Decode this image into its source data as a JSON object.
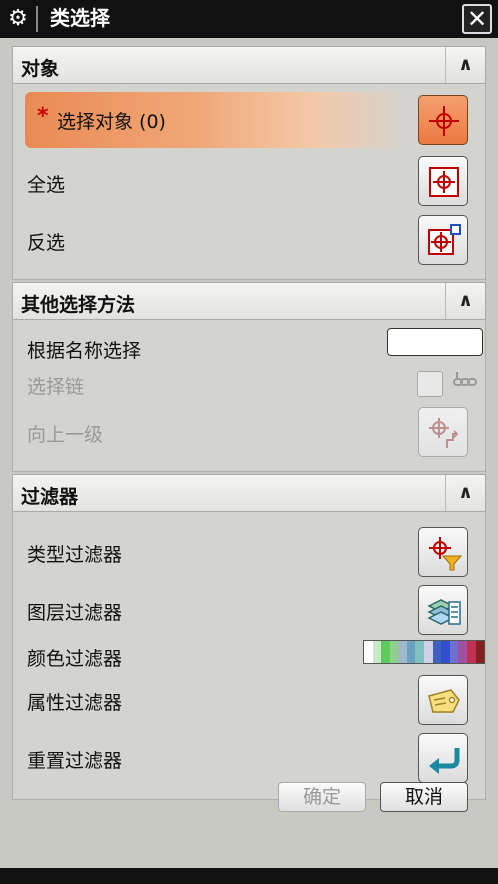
{
  "window": {
    "title": "类选择",
    "close_label": "✕",
    "gear_icon": "⚙"
  },
  "sections": {
    "object": {
      "title": "对象",
      "collapse": "∧",
      "select_object": {
        "star": "*",
        "label": "选择对象 (0)"
      },
      "select_all": "全选",
      "invert": "反选"
    },
    "other": {
      "title": "其他选择方法",
      "collapse": "∧",
      "by_name": "根据名称选择",
      "chain": "选择链",
      "up_level": "向上一级"
    },
    "filters": {
      "title": "过滤器",
      "collapse": "∧",
      "type": "类型过滤器",
      "layer": "图层过滤器",
      "color": "颜色过滤器",
      "attribute": "属性过滤器",
      "reset": "重置过滤器",
      "palette": [
        "#ffffff",
        "#c8e8c8",
        "#5ecb5e",
        "#8fd08f",
        "#a0b8c8",
        "#6aa0c0",
        "#80c0c0",
        "#d0d0e8",
        "#4060c0",
        "#3050d0",
        "#7070d0",
        "#a050a0",
        "#c03050",
        "#802020"
      ]
    }
  },
  "footer": {
    "ok": "确定",
    "cancel": "取消"
  },
  "colors": {
    "accent": "#ea7a40",
    "crosshair": "#c00000"
  }
}
